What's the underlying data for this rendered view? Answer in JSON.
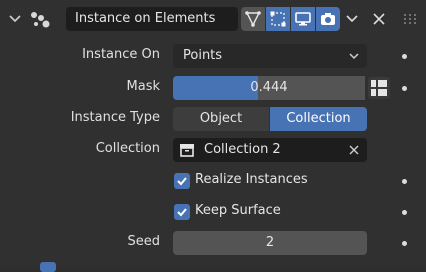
{
  "header": {
    "title": "Instance on Elements",
    "buttons": [
      "node-wrangler-icon",
      "selection-icon",
      "display-icon",
      "render-icon"
    ]
  },
  "fields": {
    "instance_on": {
      "label": "Instance On",
      "value": "Points"
    },
    "mask": {
      "label": "Mask",
      "value": "0.444",
      "fraction": 0.444
    },
    "instance_type": {
      "label": "Instance Type",
      "options": [
        "Object",
        "Collection"
      ],
      "selected": "Collection"
    },
    "collection": {
      "label": "Collection",
      "value": "Collection 2"
    },
    "realize_instances": {
      "label": "Realize Instances",
      "checked": true
    },
    "keep_surface": {
      "label": "Keep Surface",
      "checked": true
    },
    "seed": {
      "label": "Seed",
      "value": "2"
    }
  },
  "colors": {
    "accent": "#4772b3",
    "panel": "#303030",
    "field": "#1d1d1d"
  }
}
